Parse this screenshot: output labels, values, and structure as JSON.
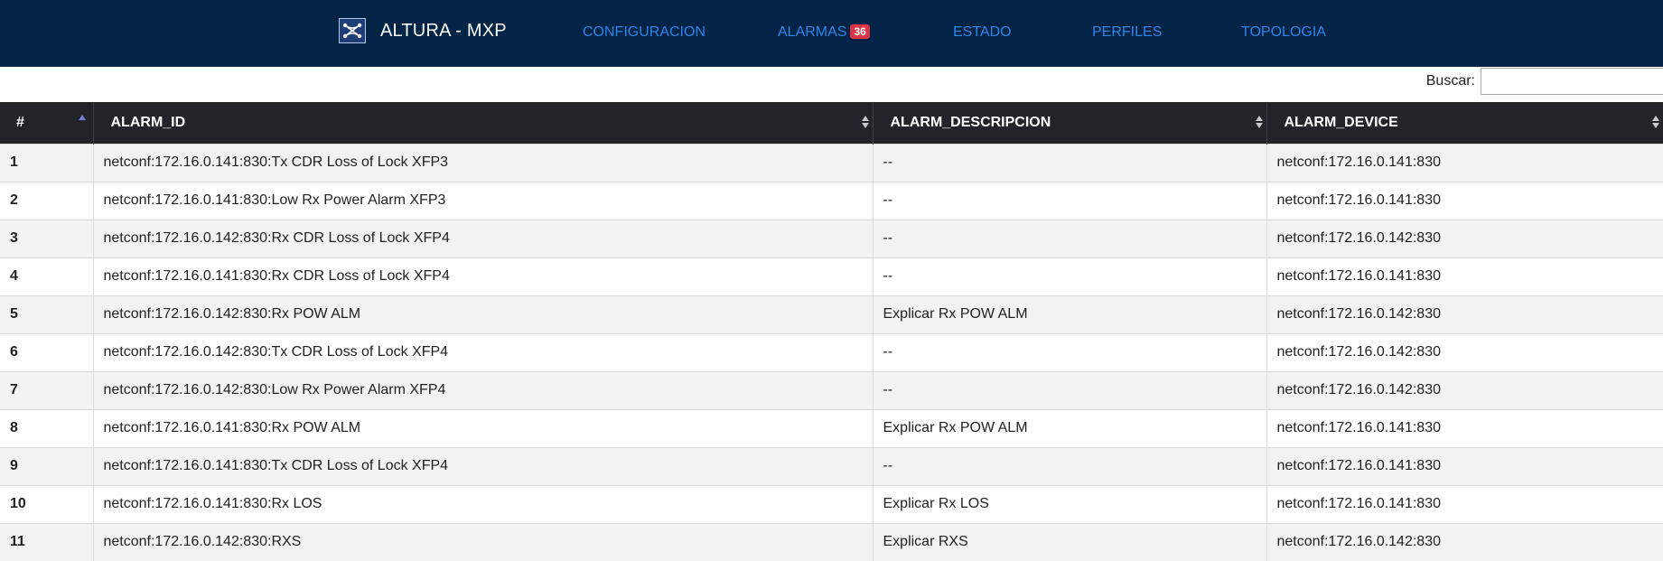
{
  "navbar": {
    "brand": "ALTURA - MXP",
    "links": {
      "configuracion": "CONFIGURACION",
      "alarmas": "ALARMAS",
      "alarmas_badge": "36",
      "estado": "ESTADO",
      "perfiles": "PERFILES",
      "topologia": "TOPOLOGIA"
    },
    "colors": {
      "background": "#022447",
      "link": "#2f84e8",
      "badge": "#dc3545"
    }
  },
  "search": {
    "label": "Buscar:",
    "value": ""
  },
  "table": {
    "headers": [
      "#",
      "ALARM_ID",
      "ALARM_DESCRIPCION",
      "ALARM_DEVICE"
    ],
    "rows": [
      [
        "1",
        "netconf:172.16.0.141:830:Tx CDR Loss of Lock XFP3",
        "--",
        "netconf:172.16.0.141:830"
      ],
      [
        "2",
        "netconf:172.16.0.141:830:Low Rx Power Alarm XFP3",
        "--",
        "netconf:172.16.0.141:830"
      ],
      [
        "3",
        "netconf:172.16.0.142:830:Rx CDR Loss of Lock XFP4",
        "--",
        "netconf:172.16.0.142:830"
      ],
      [
        "4",
        "netconf:172.16.0.141:830:Rx CDR Loss of Lock XFP4",
        "--",
        "netconf:172.16.0.141:830"
      ],
      [
        "5",
        "netconf:172.16.0.142:830:Rx POW ALM",
        "Explicar Rx POW ALM",
        "netconf:172.16.0.142:830"
      ],
      [
        "6",
        "netconf:172.16.0.142:830:Tx CDR Loss of Lock XFP4",
        "--",
        "netconf:172.16.0.142:830"
      ],
      [
        "7",
        "netconf:172.16.0.142:830:Low Rx Power Alarm XFP4",
        "--",
        "netconf:172.16.0.142:830"
      ],
      [
        "8",
        "netconf:172.16.0.141:830:Rx POW ALM",
        "Explicar Rx POW ALM",
        "netconf:172.16.0.141:830"
      ],
      [
        "9",
        "netconf:172.16.0.141:830:Tx CDR Loss of Lock XFP4",
        "--",
        "netconf:172.16.0.141:830"
      ],
      [
        "10",
        "netconf:172.16.0.141:830:Rx LOS",
        "Explicar Rx LOS",
        "netconf:172.16.0.141:830"
      ],
      [
        "11",
        "netconf:172.16.0.142:830:RXS",
        "Explicar RXS",
        "netconf:172.16.0.142:830"
      ]
    ]
  }
}
